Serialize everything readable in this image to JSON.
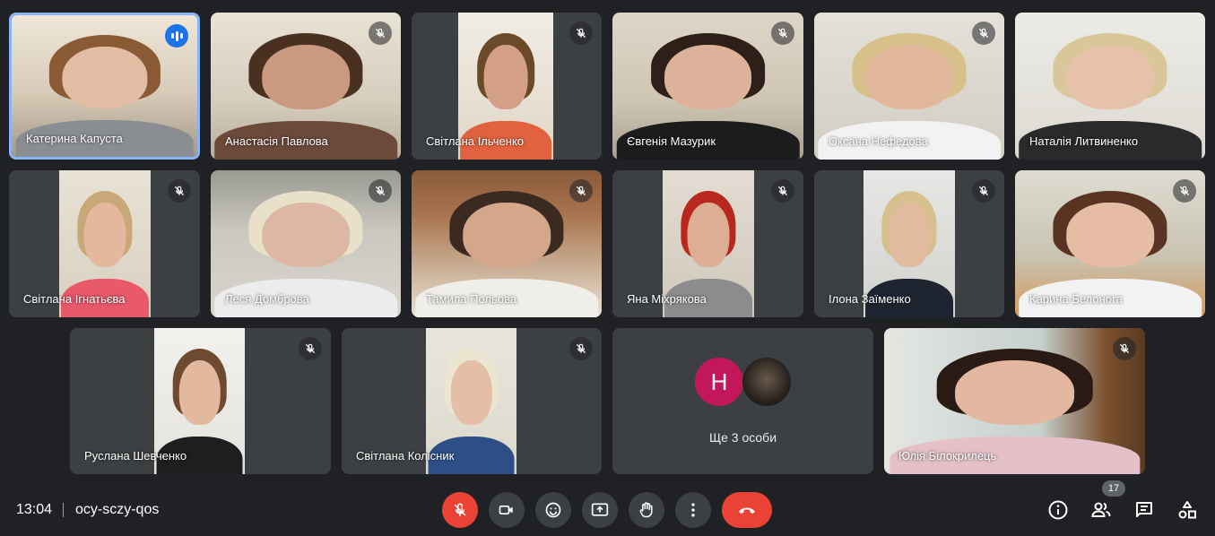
{
  "participants": [
    {
      "name": "Катерина Капуста",
      "speaking": true
    },
    {
      "name": "Анастасія Павлова",
      "muted": true
    },
    {
      "name": "Світлана Ільченко",
      "muted": true
    },
    {
      "name": "Євгенія Мазурик",
      "muted": true
    },
    {
      "name": "Оксана Нефедова",
      "muted": true
    },
    {
      "name": "Наталія Литвиненко",
      "muted": true
    },
    {
      "name": "Світлана Ігнатьєва",
      "muted": true
    },
    {
      "name": "Леся Домброва",
      "muted": true
    },
    {
      "name": "Тамила Польова",
      "muted": true
    },
    {
      "name": "Яна Міхрякова",
      "muted": true
    },
    {
      "name": "Ілона Заїменко",
      "muted": true
    },
    {
      "name": "Карина Белонога",
      "muted": true
    },
    {
      "name": "Руслана Шевченко",
      "muted": true
    },
    {
      "name": "Світлана Колісник",
      "muted": true
    },
    {
      "name": "Юлія Білокрилець",
      "muted": true
    }
  ],
  "more_tile": {
    "label": "Ще 3 особи",
    "avatar_letter": "H",
    "avatar_color": "#c2185b"
  },
  "meeting": {
    "time": "13:04",
    "code": "ocy-sczy-qos"
  },
  "controls": [
    "mic-off-icon",
    "camera-icon",
    "emoji-icon",
    "present-icon",
    "hand-icon",
    "more-icon",
    "hangup-icon"
  ],
  "right_controls": {
    "people_count": "17"
  },
  "colors": {
    "background": "#202124",
    "tile": "#3c4043",
    "danger": "#ea4335",
    "accent": "#8ab4f8",
    "speaking": "#1a73e8"
  }
}
